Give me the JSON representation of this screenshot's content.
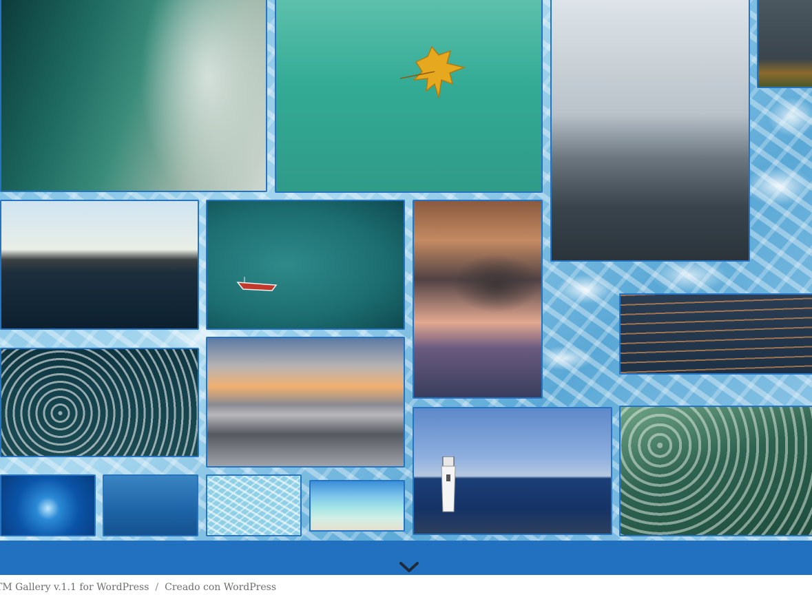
{
  "gallery": {
    "tiles": [
      {
        "name": "gallery-image-wave",
        "alt": "Breaking wave"
      },
      {
        "name": "gallery-image-leaf",
        "alt": "Leaf underwater"
      },
      {
        "name": "gallery-image-fog",
        "alt": "Foggy sea"
      },
      {
        "name": "gallery-image-corner",
        "alt": "Shore"
      },
      {
        "name": "gallery-image-lake",
        "alt": "Lake at sunset"
      },
      {
        "name": "gallery-image-boat",
        "alt": "Red boat"
      },
      {
        "name": "gallery-image-clouds",
        "alt": "Cloudy sky"
      },
      {
        "name": "gallery-image-ripples",
        "alt": "Ripples"
      },
      {
        "name": "gallery-image-foam",
        "alt": "Sea foam"
      },
      {
        "name": "gallery-image-sunset-blur",
        "alt": "Blurred sunset"
      },
      {
        "name": "gallery-image-lighthouse",
        "alt": "Lighthouse"
      },
      {
        "name": "gallery-image-green-water",
        "alt": "Green water"
      },
      {
        "name": "gallery-image-jellyfish",
        "alt": "Jellyfish"
      },
      {
        "name": "gallery-image-deep-blue",
        "alt": "Deep blue"
      },
      {
        "name": "gallery-image-pool",
        "alt": "Pool water"
      },
      {
        "name": "gallery-image-beach",
        "alt": "Beach"
      }
    ]
  },
  "footer": {
    "credit_theme": "TM Gallery v.1.1 for WordPress",
    "separator": "/",
    "credit_wp": "Creado con WordPress"
  },
  "colors": {
    "accent": "#2271c0",
    "tile_border": "#2474c3",
    "footer_text": "#6d6d6d"
  },
  "icons": {
    "scroll": "chevron-down-icon"
  }
}
